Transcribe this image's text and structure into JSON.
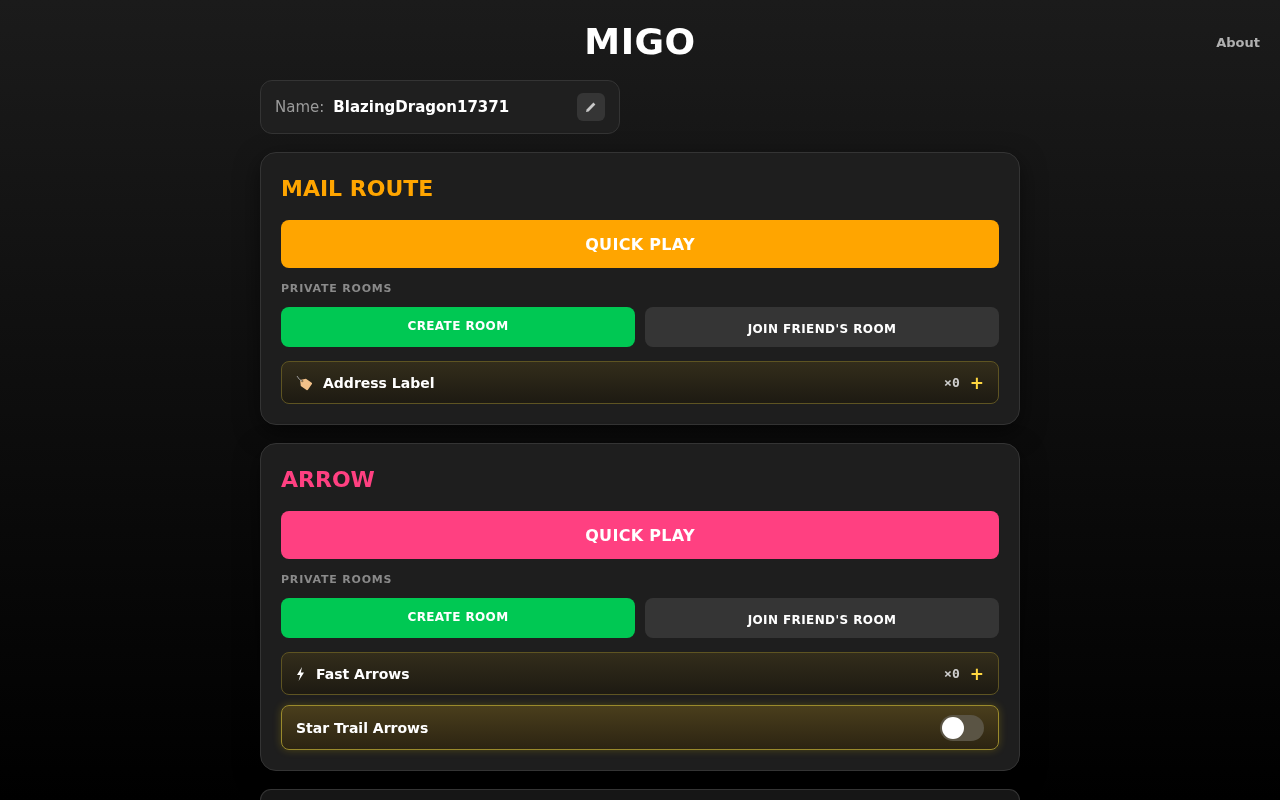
{
  "header": {
    "title": "MIGO",
    "nav": [
      {
        "label": "About"
      }
    ]
  },
  "player": {
    "label": "Name:",
    "value": "BlazingDragon17371"
  },
  "games": [
    {
      "title": "MAIL ROUTE",
      "color": "#ffa500",
      "quick_play": "QUICK PLAY",
      "section_label": "PRIVATE ROOMS",
      "create_room": "CREATE ROOM",
      "join_room": "JOIN FRIEND'S ROOM",
      "items": [
        {
          "kind": "counter",
          "label": "Address Label",
          "count": "×0",
          "add": "+"
        }
      ]
    },
    {
      "title": "ARROW",
      "color": "#ff4081",
      "quick_play": "QUICK PLAY",
      "section_label": "PRIVATE ROOMS",
      "create_room": "CREATE ROOM",
      "join_room": "JOIN FRIEND'S ROOM",
      "items": [
        {
          "kind": "counter",
          "label": "Fast Arrows",
          "count": "×0",
          "add": "+"
        },
        {
          "kind": "toggle",
          "label": "Star Trail Arrows",
          "on": false
        }
      ]
    }
  ]
}
